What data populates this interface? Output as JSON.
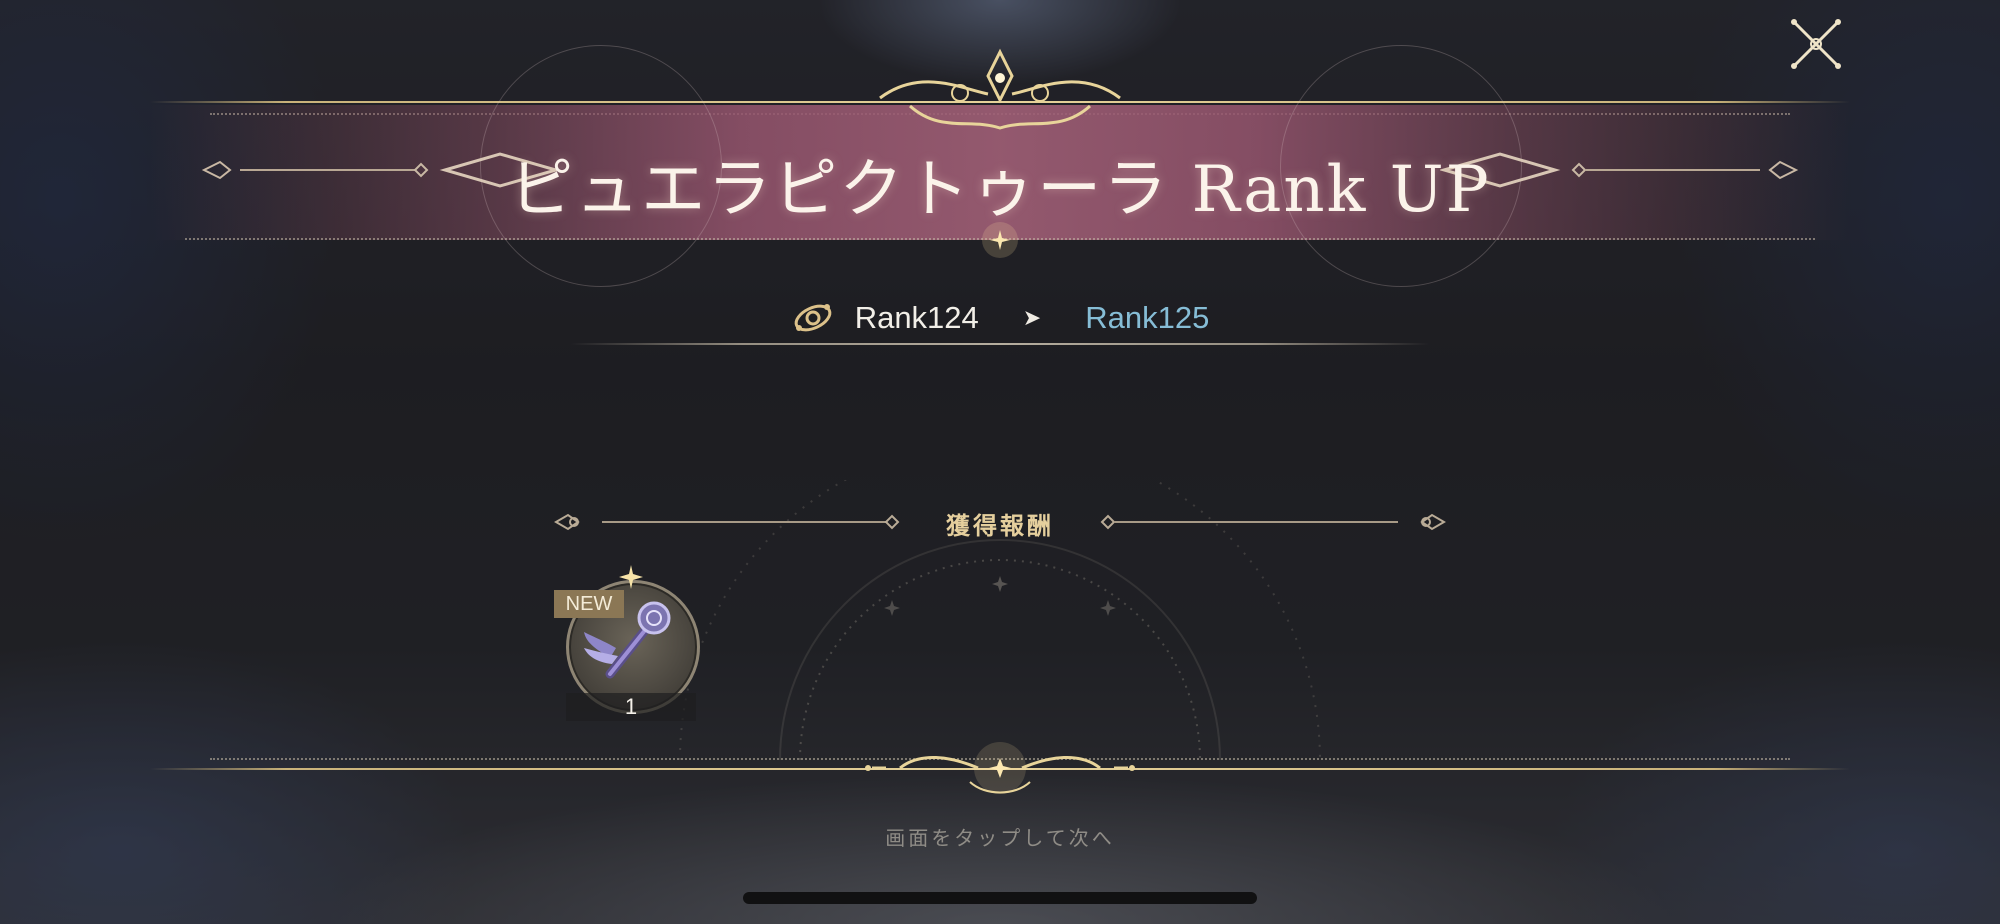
{
  "header": {
    "title": "ピュエラピクトゥーラ Rank UP"
  },
  "rank": {
    "from": "Rank124",
    "arrow": "➤",
    "to": "Rank125"
  },
  "rewards": {
    "title": "獲得報酬",
    "items": [
      {
        "badge": "NEW",
        "count": "1",
        "icon": "winged-staff-icon"
      }
    ]
  },
  "footer": {
    "hint": "画面をタップして次へ"
  },
  "colors": {
    "gold": "#e6d29a",
    "banner": "#a05f76",
    "rank_next": "#86bdd6",
    "reward_title": "#e5cf9d"
  }
}
